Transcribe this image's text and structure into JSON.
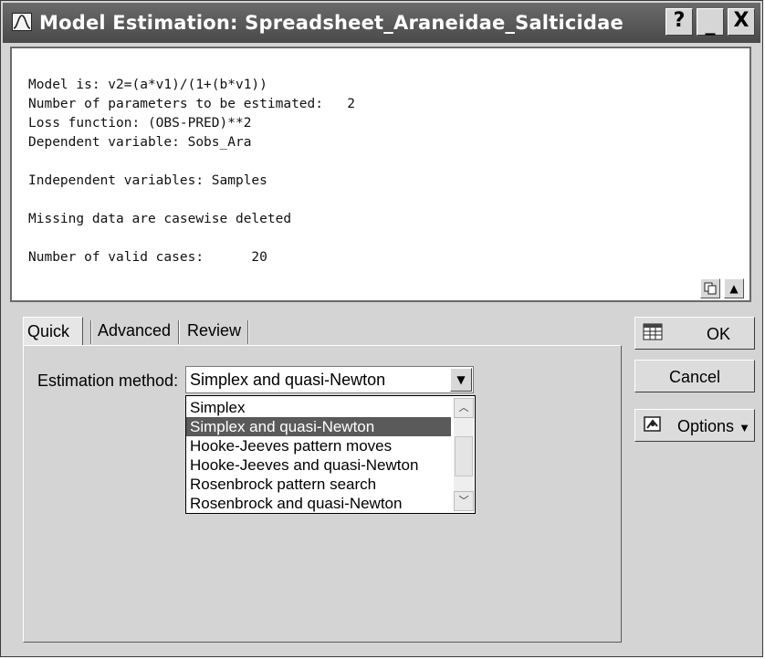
{
  "window": {
    "title": "Model Estimation: Spreadsheet_Araneidae_Salticidae",
    "help_label": "?",
    "minimize_label": "_",
    "close_label": "X"
  },
  "output": {
    "lines": [
      "Model is: v2=(a*v1)/(1+(b*v1))",
      "Number of parameters to be estimated:   2",
      "Loss function: (OBS-PRED)**2",
      "Dependent variable: Sobs_Ara",
      "",
      "Independent variables: Samples",
      "",
      "Missing data are casewise deleted",
      "",
      "Number of valid cases:      20"
    ]
  },
  "tabs": [
    {
      "label": "Quick",
      "active": true
    },
    {
      "label": "Advanced",
      "active": false
    },
    {
      "label": "Review",
      "active": false
    }
  ],
  "estimation": {
    "label": "Estimation method:",
    "value": "Simplex and quasi-Newton",
    "options": [
      "Simplex",
      "Simplex and quasi-Newton",
      "Hooke-Jeeves pattern moves",
      "Hooke-Jeeves and quasi-Newton",
      "Rosenbrock pattern search",
      "Rosenbrock and quasi-Newton"
    ],
    "selected_index": 1
  },
  "buttons": {
    "ok": "OK",
    "cancel": "Cancel",
    "options": "Options"
  },
  "icons": {
    "app": "normal-curve-icon",
    "ok": "grid-icon",
    "options": "options-icon",
    "copy": "copy-icon",
    "up": "arrow-up-icon"
  }
}
